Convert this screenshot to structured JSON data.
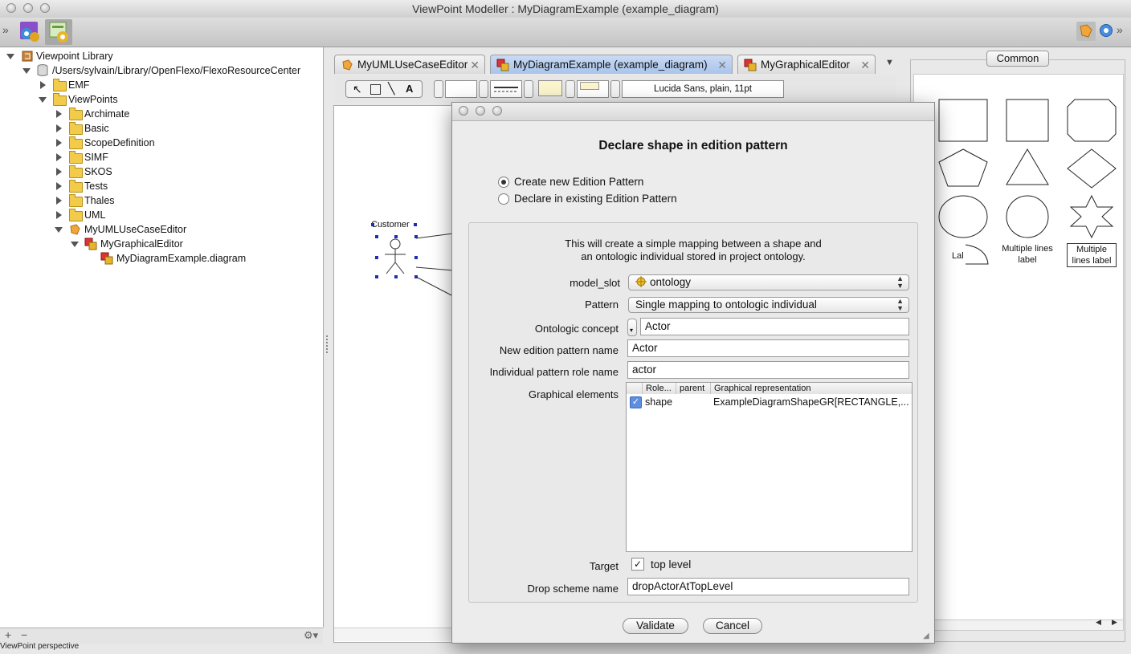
{
  "window": {
    "title": "ViewPoint Modeller : MyDiagramExample (example_diagram)"
  },
  "tree": {
    "items": [
      {
        "label": "Viewpoint Library"
      },
      {
        "label": "/Users/sylvain/Library/OpenFlexo/FlexoResourceCenter"
      },
      {
        "label": "EMF"
      },
      {
        "label": "ViewPoints"
      },
      {
        "label": "Archimate"
      },
      {
        "label": "Basic"
      },
      {
        "label": "ScopeDefinition"
      },
      {
        "label": "SIMF"
      },
      {
        "label": "SKOS"
      },
      {
        "label": "Tests"
      },
      {
        "label": "Thales"
      },
      {
        "label": "UML"
      },
      {
        "label": "MyUMLUseCaseEditor"
      },
      {
        "label": "MyGraphicalEditor"
      },
      {
        "label": "MyDiagramExample.diagram"
      }
    ]
  },
  "status": {
    "perspective": "ViewPoint perspective"
  },
  "tabs": [
    {
      "label": "MyUMLUseCaseEditor"
    },
    {
      "label": "MyDiagramExample (example_diagram)"
    },
    {
      "label": "MyGraphicalEditor"
    }
  ],
  "editor_toolbar": {
    "font": "Lucida Sans, plain, 11pt"
  },
  "canvas": {
    "actor_label": "Customer"
  },
  "palette": {
    "tab": "Common",
    "labels": {
      "lab": "Lal",
      "multi1": "Multiple lines label",
      "multi2": "Multiple lines label"
    }
  },
  "dialog": {
    "heading": "Declare shape in edition pattern",
    "radio_new": "Create new Edition Pattern",
    "radio_existing": "Declare in existing Edition Pattern",
    "description_line1": "This will create a simple mapping between a shape and",
    "description_line2": "an ontologic individual stored in project ontology.",
    "model_slot_label": "model_slot",
    "model_slot_value": "ontology",
    "pattern_label": "Pattern",
    "pattern_value": "Single mapping to ontologic individual",
    "concept_label": "Ontologic concept",
    "concept_value": "Actor",
    "ep_name_label": "New edition pattern name",
    "ep_name_value": "Actor",
    "role_name_label": "Individual pattern role name",
    "role_name_value": "actor",
    "graphical_label": "Graphical elements",
    "table": {
      "headers": [
        "Role...",
        "parent",
        "Graphical representation"
      ],
      "rows": [
        {
          "checked": true,
          "role": "shape",
          "parent": "",
          "repr": "ExampleDiagramShapeGR[RECTANGLE,..."
        }
      ]
    },
    "target_label": "Target",
    "target_value": "top level",
    "drop_label": "Drop scheme name",
    "drop_value": "dropActorAtTopLevel",
    "validate": "Validate",
    "cancel": "Cancel"
  }
}
